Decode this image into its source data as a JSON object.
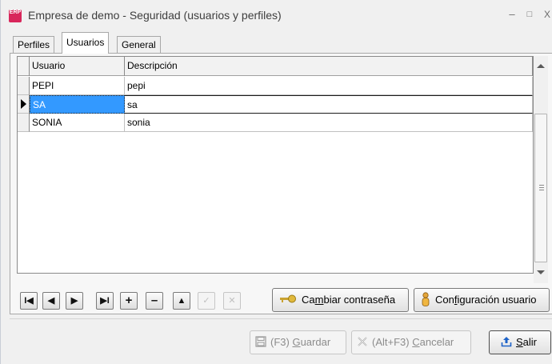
{
  "window": {
    "app_icon_text": "ERP",
    "title": "Empresa de demo - Seguridad (usuarios y perfiles)",
    "minimize": "–",
    "maximize": "□",
    "close": "X"
  },
  "tabs": [
    {
      "label": "Perfiles",
      "active": false
    },
    {
      "label": "Usuarios",
      "active": true
    },
    {
      "label": "General",
      "active": false
    }
  ],
  "grid": {
    "columns": [
      "Usuario",
      "Descripción"
    ],
    "rows": [
      {
        "usuario": "PEPI",
        "descripcion": "pepi"
      },
      {
        "usuario": "SA",
        "descripcion": "sa",
        "current": true
      },
      {
        "usuario": "SONIA",
        "descripcion": "sonia"
      }
    ]
  },
  "navigator": {
    "first": "I◀",
    "prior": "◀",
    "next": "▶",
    "last": "▶I",
    "insert": "+",
    "delete": "–",
    "edit": "▲",
    "post": "✓",
    "cancel": "✕"
  },
  "actions": {
    "change_password_pre": "Ca",
    "change_password_ul": "m",
    "change_password_post": "biar contraseña",
    "user_config_pre": "Con",
    "user_config_ul": "f",
    "user_config_post": "iguración usuario"
  },
  "footer": {
    "save_pre": "(F3) ",
    "save_ul": "G",
    "save_post": "uardar",
    "cancel_pre": "(Alt+F3) ",
    "cancel_ul": "C",
    "cancel_post": "ancelar",
    "exit_ul": "S",
    "exit_post": "alir"
  },
  "icons": {
    "save": "floppy-disk-icon",
    "cancel": "x-icon",
    "exit": "upload-exit-icon",
    "key": "key-icon",
    "user": "user-icon"
  }
}
